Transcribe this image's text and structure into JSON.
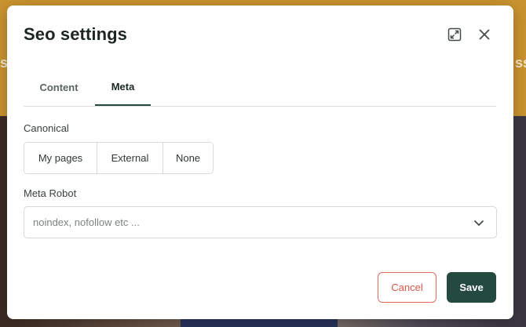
{
  "background": {
    "band_color": "#c9932f",
    "left_edge_text": "st",
    "right_edge_text": "ss"
  },
  "modal": {
    "title": "Seo settings",
    "expand_icon": "expand-icon",
    "close_icon": "close-icon"
  },
  "tabs": [
    {
      "label": "Content",
      "active": false
    },
    {
      "label": "Meta",
      "active": true
    }
  ],
  "canonical": {
    "label": "Canonical",
    "options": [
      "My pages",
      "External",
      "None"
    ]
  },
  "meta_robot": {
    "label": "Meta Robot",
    "placeholder": "noindex, nofollow etc ..."
  },
  "actions": {
    "cancel_label": "Cancel",
    "save_label": "Save"
  },
  "colors": {
    "accent": "#24493f",
    "cancel": "#d9584b"
  }
}
